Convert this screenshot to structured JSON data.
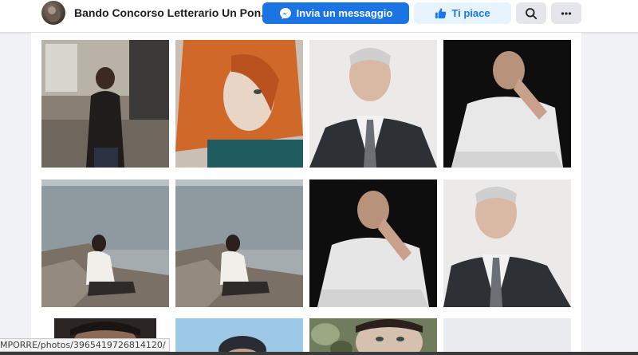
{
  "header": {
    "page_name": "Bando Concorso Letterario Un Pon...",
    "message_button_label": "Invia un messaggio",
    "like_button_label": "Ti piace",
    "search_icon": "search-icon",
    "more_icon": "more-horizontal-icon",
    "colors": {
      "primary": "#1b74e4",
      "like_bg": "#e7f3ff",
      "like_text": "#1877f2",
      "icon_bg": "#e4e6eb"
    }
  },
  "status_bar": {
    "url_text": "MPORRE/photos/3965419726814120/"
  },
  "photos": [
    {
      "label": "woman-in-black-by-window"
    },
    {
      "label": "red-haired-woman"
    },
    {
      "label": "grey-haired-man-in-suit"
    },
    {
      "label": "man-in-white-shirt-dark"
    },
    {
      "label": "woman-on-rocks-by-lake"
    },
    {
      "label": "woman-on-rocks-by-lake-duplicate"
    },
    {
      "label": "man-in-white-shirt-dark"
    },
    {
      "label": "grey-haired-man-in-suit"
    },
    {
      "label": "woman-close-up"
    },
    {
      "label": "man-with-blue-sky"
    },
    {
      "label": "woman-with-leaves"
    },
    {
      "label": "empty-placeholder"
    }
  ]
}
